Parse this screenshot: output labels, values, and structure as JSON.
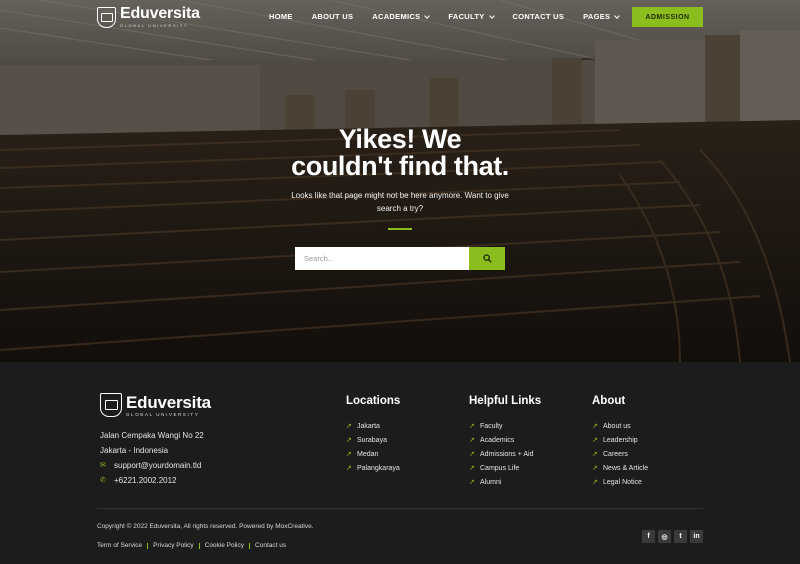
{
  "brand": {
    "name": "Eduversita",
    "tagline": "GLOBAL UNIVERSITY"
  },
  "nav": {
    "items": [
      {
        "label": "HOME",
        "dropdown": false
      },
      {
        "label": "ABOUT US",
        "dropdown": false
      },
      {
        "label": "ACADEMICS",
        "dropdown": true
      },
      {
        "label": "FACULTY",
        "dropdown": true
      },
      {
        "label": "CONTACT US",
        "dropdown": false
      },
      {
        "label": "PAGES",
        "dropdown": true
      }
    ],
    "cta_label": "ADMISSION"
  },
  "hero": {
    "title_line1": "Yikes! We",
    "title_line2": "couldn't find that.",
    "subtitle": "Looks like that page might not be here anymore. Want to give search a try?"
  },
  "search": {
    "placeholder": "Search...",
    "icon": "search-icon"
  },
  "footer": {
    "contact": {
      "address_line1": "Jalan Cempaka Wangi No 22",
      "address_line2": "Jakarta - Indonesia",
      "email": "support@yourdomain.tld",
      "phone": "+6221.2002.2012"
    },
    "columns": [
      {
        "title": "Locations",
        "links": [
          "Jakarta",
          "Surabaya",
          "Medan",
          "Palangkaraya"
        ]
      },
      {
        "title": "Helpful Links",
        "links": [
          "Faculty",
          "Academics",
          "Admissions + Aid",
          "Campus Life",
          "Alumni"
        ]
      },
      {
        "title": "About",
        "links": [
          "About us",
          "Leadership",
          "Careers",
          "News & Article",
          "Legal Notice"
        ]
      }
    ],
    "copyright": "Copyright © 2022 Eduversita, All rights reserved. Powered by MoxCreative.",
    "legal_links": [
      "Term of Service",
      "Privacy Policy",
      "Cookie Policy",
      "Contact us"
    ],
    "social": [
      {
        "name": "facebook-icon",
        "glyph": "f"
      },
      {
        "name": "instagram-icon",
        "glyph": "◎"
      },
      {
        "name": "twitter-icon",
        "glyph": "t"
      },
      {
        "name": "linkedin-icon",
        "glyph": "in"
      }
    ]
  },
  "colors": {
    "accent": "#8cbd1f",
    "footer_bg": "#1c1c1c"
  }
}
